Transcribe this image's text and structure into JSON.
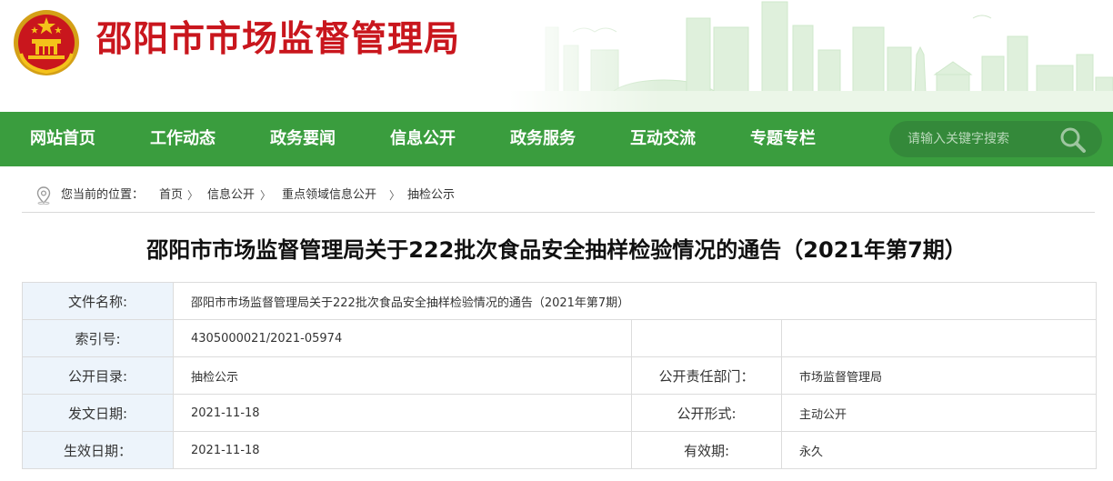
{
  "site": {
    "title": "邵阳市市场监督管理局"
  },
  "nav": {
    "items": [
      "网站首页",
      "工作动态",
      "政务要闻",
      "信息公开",
      "政务服务",
      "互动交流",
      "专题专栏"
    ]
  },
  "search": {
    "placeholder": "请输入关键字搜索"
  },
  "breadcrumb": {
    "prefix": "您当前的位置：",
    "items": [
      "首页",
      "信息公开",
      "重点领域信息公开",
      "抽检公示"
    ],
    "separator": "〉"
  },
  "article": {
    "title": "邵阳市市场监督管理局关于222批次食品安全抽样检验情况的通告（2021年第7期）"
  },
  "meta": {
    "file_name_label": "文件名称:",
    "file_name_value": "邵阳市市场监督管理局关于222批次食品安全抽样检验情况的通告（2021年第7期）",
    "index_label": "索引号:",
    "index_value": "4305000021/2021-05974",
    "catalog_label": "公开目录:",
    "catalog_value": "抽检公示",
    "dept_label": "公开责任部门：",
    "dept_value": "市场监督管理局",
    "issue_date_label": "发文日期:",
    "issue_date_value": "2021-11-18",
    "form_label": "公开形式:",
    "form_value": "主动公开",
    "effective_date_label": "生效日期：",
    "effective_date_value": "2021-11-18",
    "validity_label": "有效期:",
    "validity_value": "永久"
  },
  "colors": {
    "brand_red": "#c9161d",
    "nav_green": "#3a9d3e",
    "label_bg": "#edf4fb"
  },
  "icons": [
    "national-emblem",
    "search-icon",
    "location-pin-icon"
  ]
}
